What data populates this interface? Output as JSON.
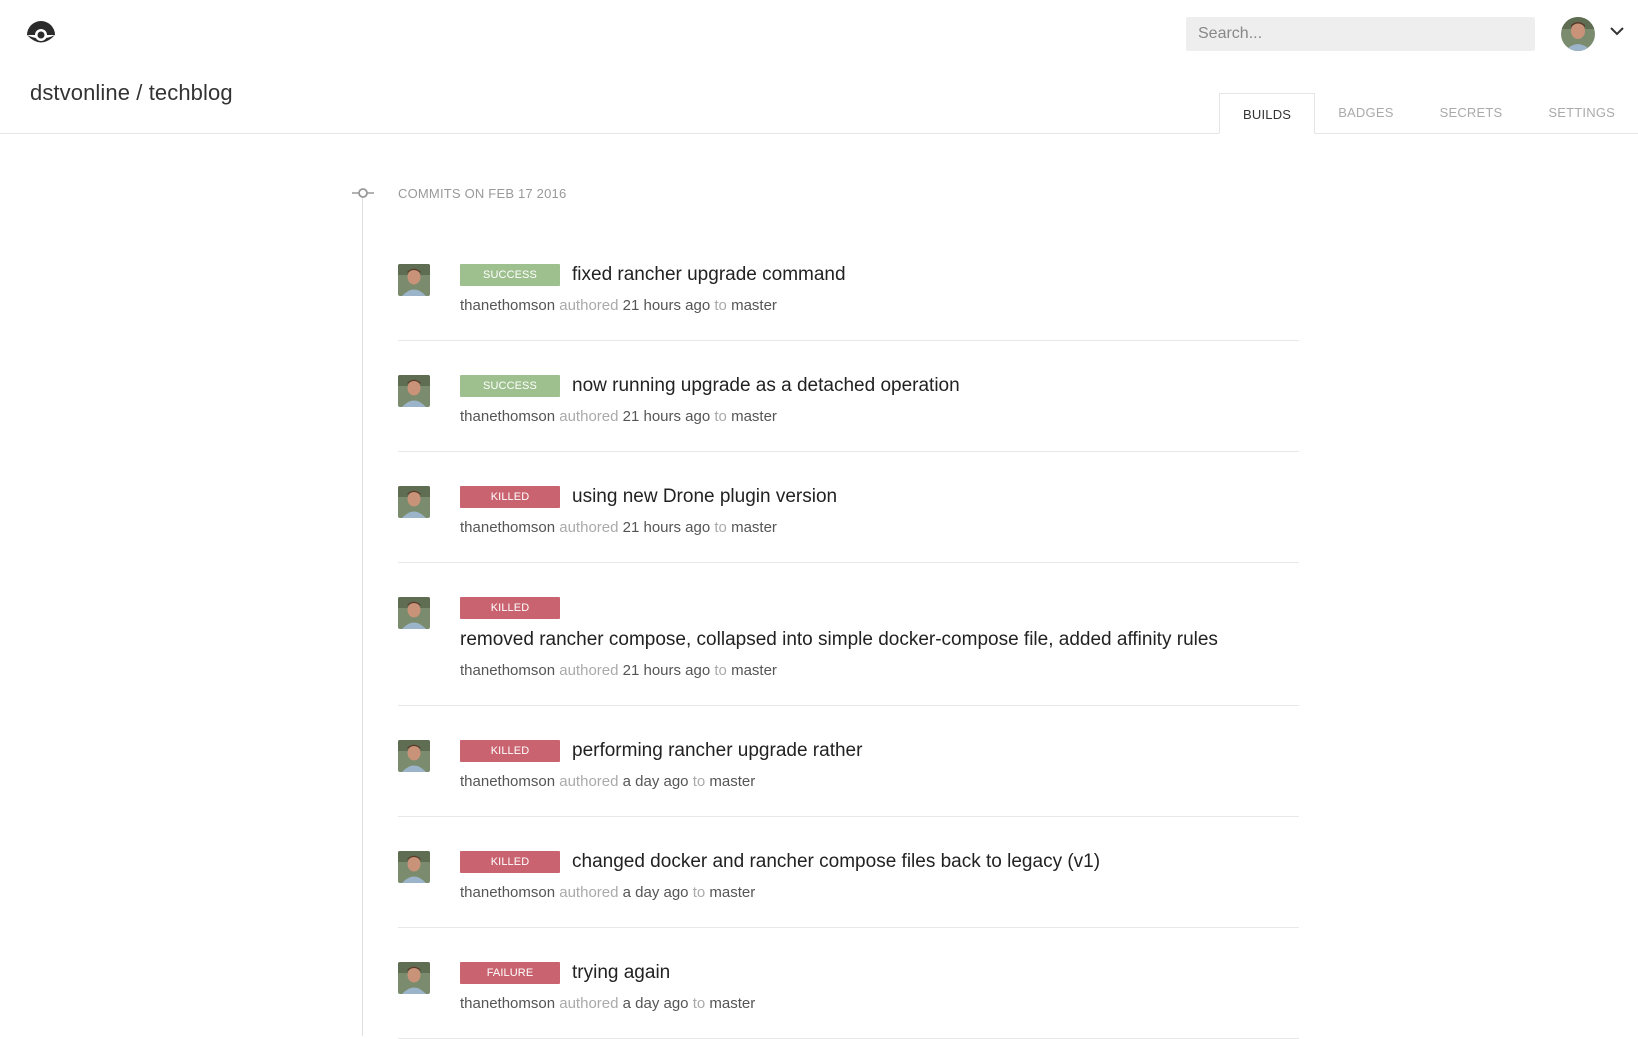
{
  "header": {
    "logo_icon": "drone-logo-icon",
    "search": {
      "placeholder": "Search...",
      "value": ""
    },
    "user_avatar_icon": "user-avatar-icon",
    "menu_icon": "chevron-down-icon"
  },
  "repo": {
    "title": "dstvonline / techblog"
  },
  "tabs": [
    {
      "label": "BUILDS",
      "active": true
    },
    {
      "label": "BADGES",
      "active": false
    },
    {
      "label": "SECRETS",
      "active": false
    },
    {
      "label": "SETTINGS",
      "active": false
    }
  ],
  "timeline": {
    "commit_icon": "commit-icon",
    "group_header": "COMMITS ON FEB 17 2016"
  },
  "builds": [
    {
      "status": "SUCCESS",
      "message": "fixed rancher upgrade command",
      "author": "thanethomson",
      "authored": "authored",
      "time": "21 hours ago",
      "to": "to",
      "branch": "master"
    },
    {
      "status": "SUCCESS",
      "message": "now running upgrade as a detached operation",
      "author": "thanethomson",
      "authored": "authored",
      "time": "21 hours ago",
      "to": "to",
      "branch": "master"
    },
    {
      "status": "KILLED",
      "message": "using new Drone plugin version",
      "author": "thanethomson",
      "authored": "authored",
      "time": "21 hours ago",
      "to": "to",
      "branch": "master"
    },
    {
      "status": "KILLED",
      "message": "removed rancher compose, collapsed into simple docker-compose file, added affinity rules",
      "author": "thanethomson",
      "authored": "authored",
      "time": "21 hours ago",
      "to": "to",
      "branch": "master"
    },
    {
      "status": "KILLED",
      "message": "performing rancher upgrade rather",
      "author": "thanethomson",
      "authored": "authored",
      "time": "a day ago",
      "to": "to",
      "branch": "master"
    },
    {
      "status": "KILLED",
      "message": "changed docker and rancher compose files back to legacy (v1)",
      "author": "thanethomson",
      "authored": "authored",
      "time": "a day ago",
      "to": "to",
      "branch": "master"
    },
    {
      "status": "FAILURE",
      "message": "trying again",
      "author": "thanethomson",
      "authored": "authored",
      "time": "a day ago",
      "to": "to",
      "branch": "master"
    }
  ],
  "colors": {
    "success": "#9ec08f",
    "killed": "#c9636f",
    "failure": "#c9636f"
  }
}
